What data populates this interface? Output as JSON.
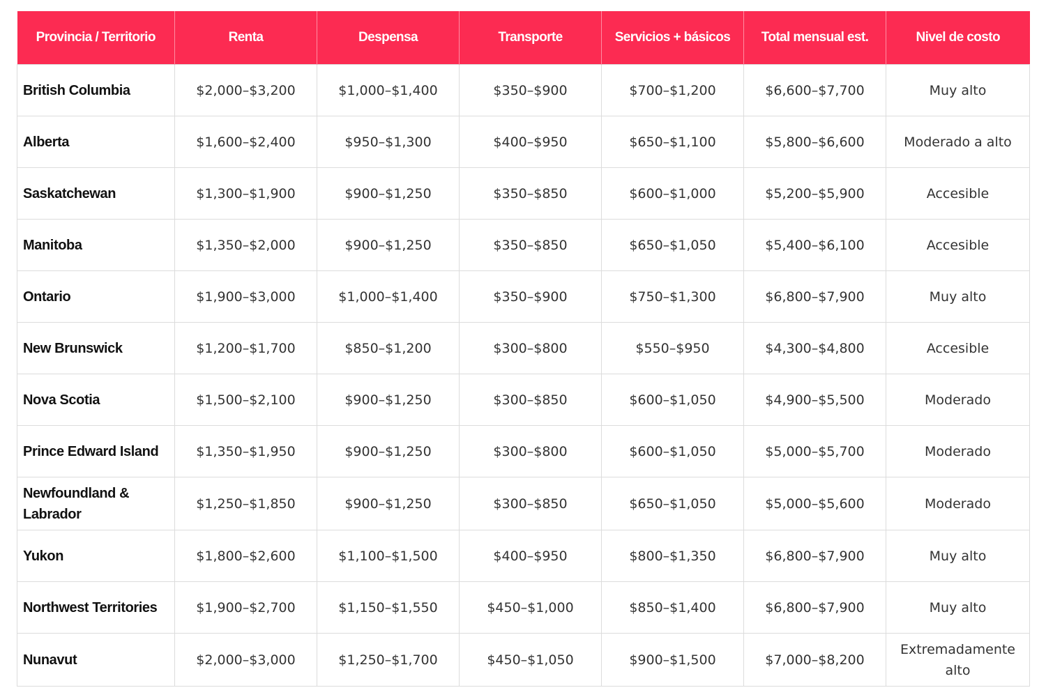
{
  "table": {
    "headers": [
      "Provincia / Territorio",
      "Renta",
      "Despensa",
      "Transporte",
      "Servicios + básicos",
      "Total mensual est.",
      "Nivel de costo"
    ],
    "rows": [
      [
        "British Columbia",
        "$2,000–$3,200",
        "$1,000–$1,400",
        "$350–$900",
        "$700–$1,200",
        "$6,600–$7,700",
        "Muy alto"
      ],
      [
        "Alberta",
        "$1,600–$2,400",
        "$950–$1,300",
        "$400–$950",
        "$650–$1,100",
        "$5,800–$6,600",
        "Moderado a alto"
      ],
      [
        "Saskatchewan",
        "$1,300–$1,900",
        "$900–$1,250",
        "$350–$850",
        "$600–$1,000",
        "$5,200–$5,900",
        "Accesible"
      ],
      [
        "Manitoba",
        "$1,350–$2,000",
        "$900–$1,250",
        "$350–$850",
        "$650–$1,050",
        "$5,400–$6,100",
        "Accesible"
      ],
      [
        "Ontario",
        "$1,900–$3,000",
        "$1,000–$1,400",
        "$350–$900",
        "$750–$1,300",
        "$6,800–$7,900",
        "Muy alto"
      ],
      [
        "New Brunswick",
        "$1,200–$1,700",
        "$850–$1,200",
        "$300–$800",
        "$550–$950",
        "$4,300–$4,800",
        "Accesible"
      ],
      [
        "Nova Scotia",
        "$1,500–$2,100",
        "$900–$1,250",
        "$300–$850",
        "$600–$1,050",
        "$4,900–$5,500",
        "Moderado"
      ],
      [
        "Prince Edward Island",
        "$1,350–$1,950",
        "$900–$1,250",
        "$300–$800",
        "$600–$1,050",
        "$5,000–$5,700",
        "Moderado"
      ],
      [
        "Newfoundland & Labrador",
        "$1,250–$1,850",
        "$900–$1,250",
        "$300–$850",
        "$650–$1,050",
        "$5,000–$5,600",
        "Moderado"
      ],
      [
        "Yukon",
        "$1,800–$2,600",
        "$1,100–$1,500",
        "$400–$950",
        "$800–$1,350",
        "$6,800–$7,900",
        "Muy alto"
      ],
      [
        "Northwest Territories",
        "$1,900–$2,700",
        "$1,150–$1,550",
        "$450–$1,000",
        "$850–$1,400",
        "$6,800–$7,900",
        "Muy alto"
      ],
      [
        "Nunavut",
        "$2,000–$3,000",
        "$1,250–$1,700",
        "$450–$1,050",
        "$900–$1,500",
        "$7,000–$8,200",
        "Extremadamente alto"
      ]
    ]
  },
  "colors": {
    "header_background": "#fc2b52",
    "header_text": "#ffffff",
    "border": "#dcdcdc"
  }
}
